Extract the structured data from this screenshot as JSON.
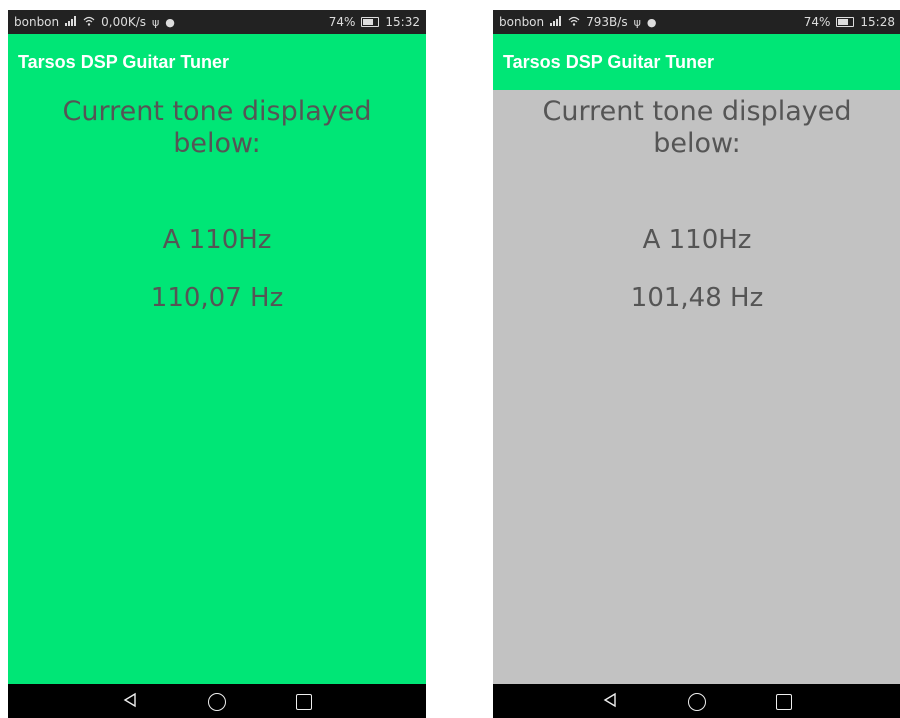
{
  "screens": [
    {
      "status": {
        "carrier": "bonbon",
        "speed": "0,00K/s",
        "battery": "74%",
        "time": "15:32"
      },
      "app_title": "Tarsos DSP Guitar Tuner",
      "heading": "Current tone displayed below:",
      "note": "A 110Hz",
      "frequency": "110,07 Hz",
      "background_color": "#00e676"
    },
    {
      "status": {
        "carrier": "bonbon",
        "speed": "793B/s",
        "battery": "74%",
        "time": "15:28"
      },
      "app_title": "Tarsos DSP Guitar Tuner",
      "heading": "Current tone displayed below:",
      "note": "A 110Hz",
      "frequency": "101,48 Hz",
      "background_color": "#c2c2c2"
    }
  ],
  "icons": {
    "signal": "signal-icon",
    "wifi": "wifi-icon",
    "usb": "usb-icon",
    "messenger": "messenger-icon",
    "battery": "battery-icon",
    "back": "back-icon",
    "home": "home-icon",
    "recent": "recent-apps-icon"
  },
  "colors": {
    "appbar": "#00e676",
    "in_tune_bg": "#00e676",
    "off_tune_bg": "#c2c2c2"
  }
}
